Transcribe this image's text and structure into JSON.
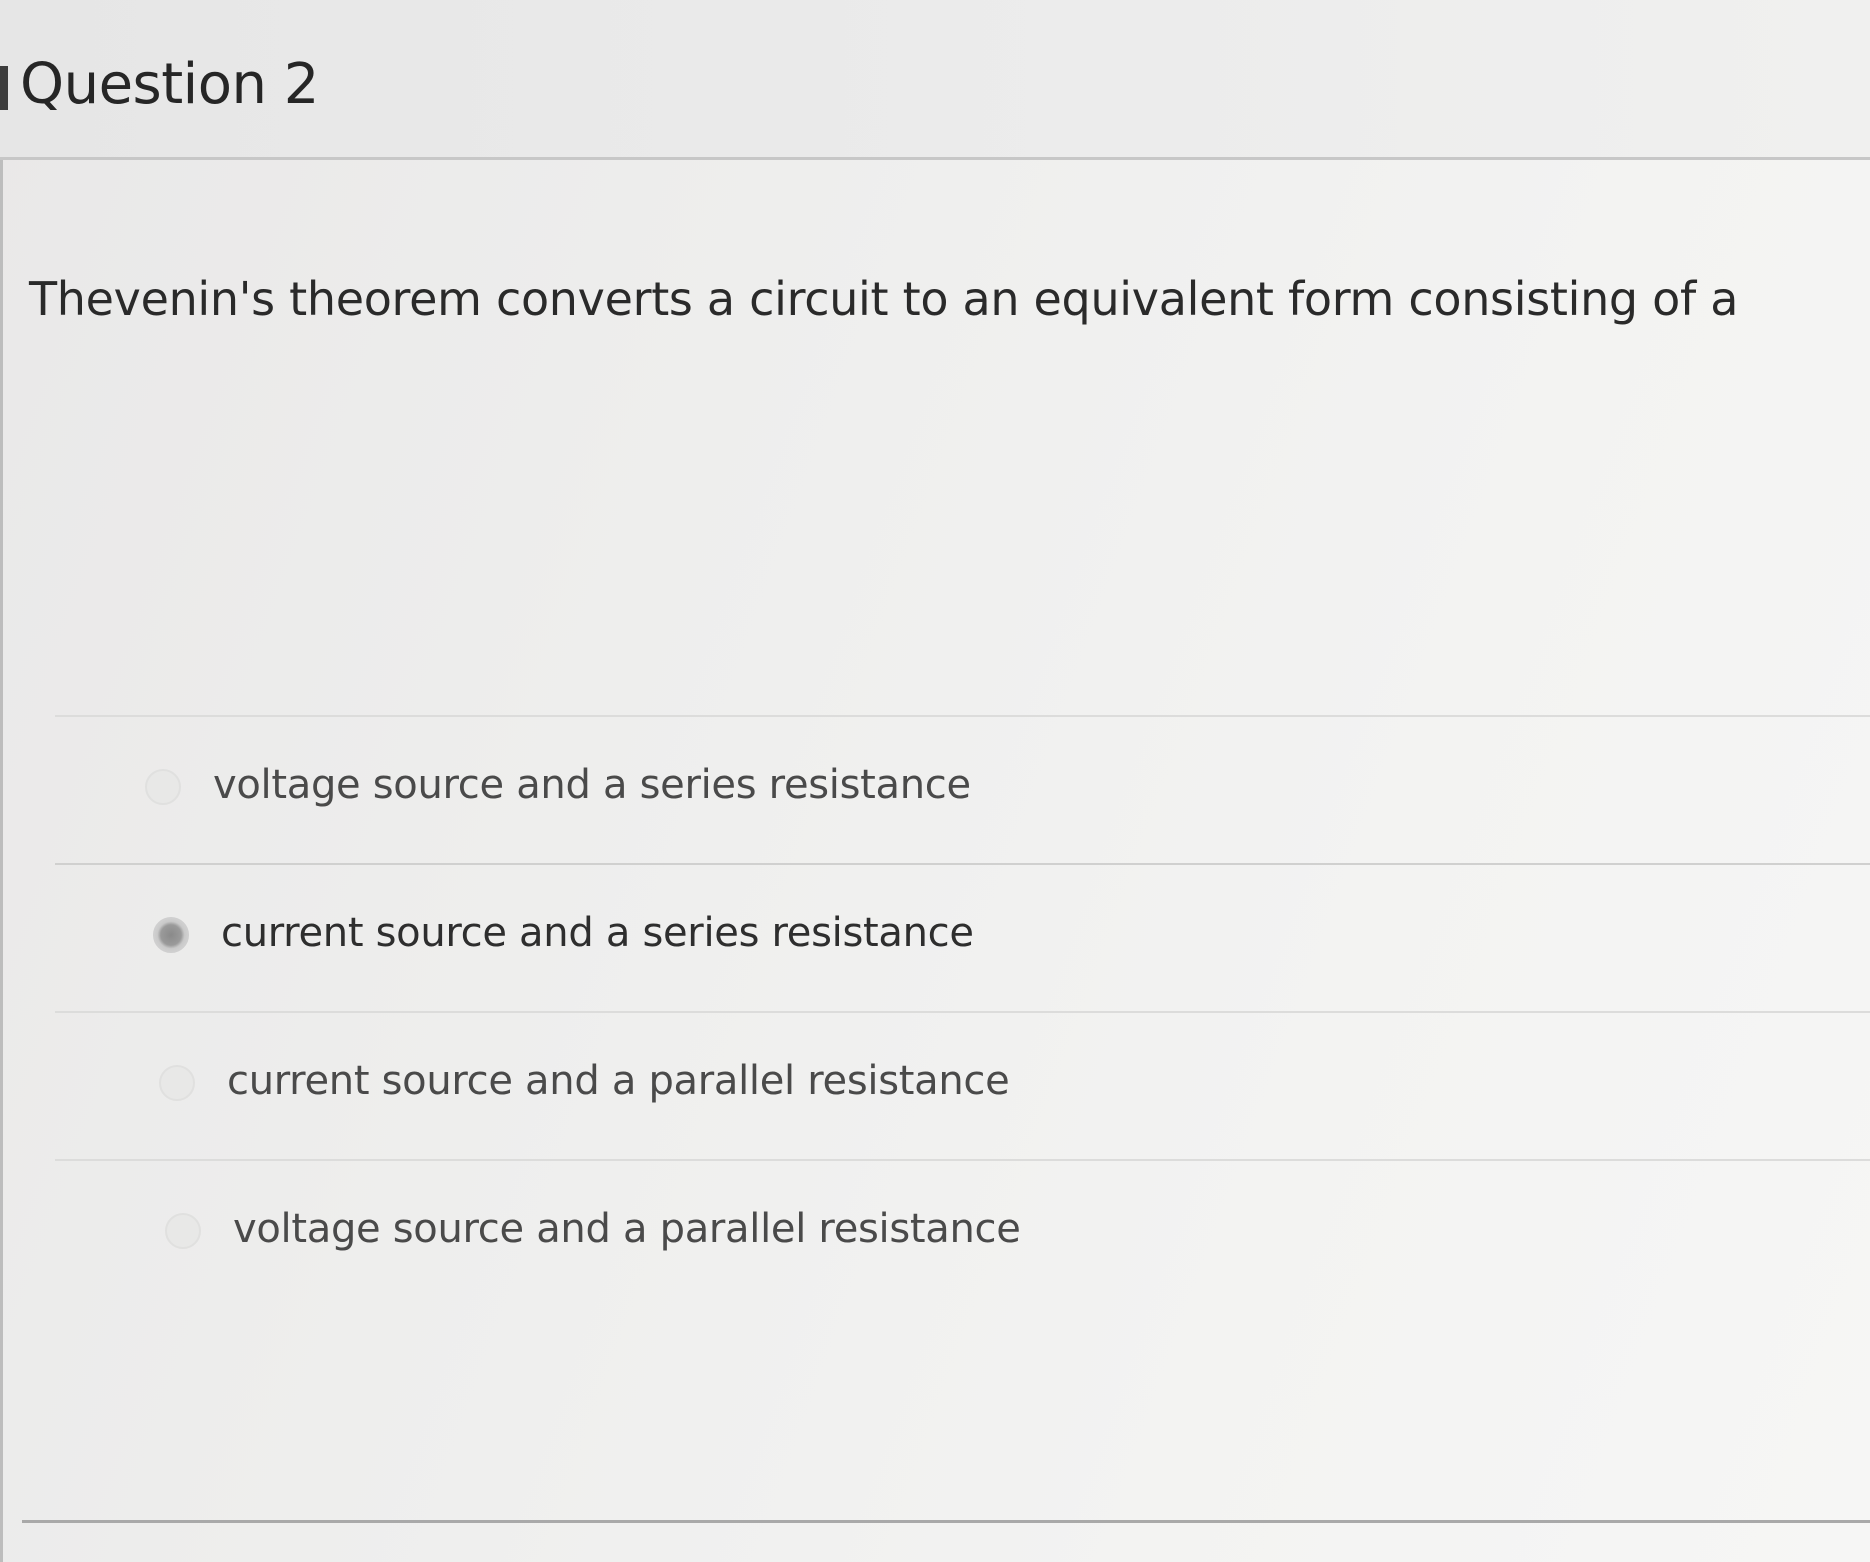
{
  "question": {
    "title": "Question 2",
    "text": "Thevenin's theorem converts a circuit to an equivalent form consisting of a"
  },
  "answers": [
    {
      "label": "voltage source and a series resistance",
      "selected": false
    },
    {
      "label": "current source and a series resistance",
      "selected": true
    },
    {
      "label": "current source and a parallel resistance",
      "selected": false
    },
    {
      "label": "voltage source and a parallel resistance",
      "selected": false
    }
  ]
}
